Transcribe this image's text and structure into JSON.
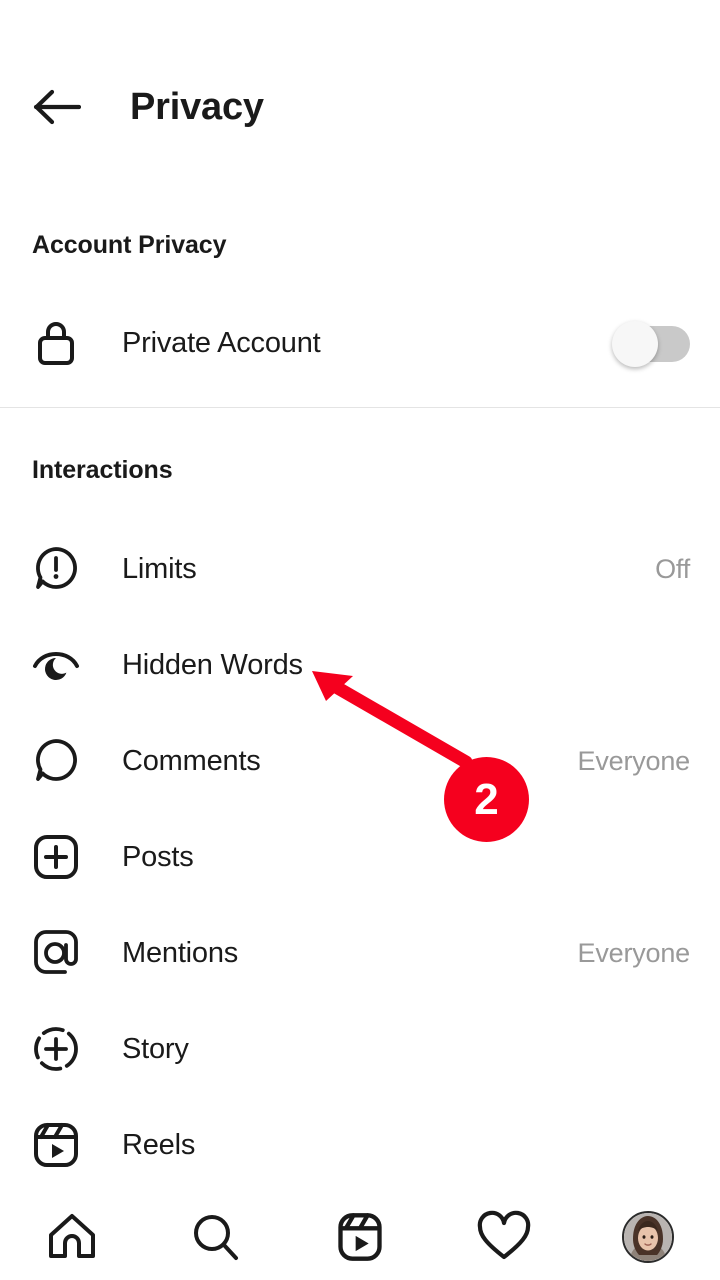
{
  "header": {
    "title": "Privacy",
    "back_icon": "arrow-left-icon"
  },
  "sections": [
    {
      "id": "account-privacy",
      "title": "Account Privacy",
      "rows": [
        {
          "label": "Private Account",
          "icon": "lock-icon",
          "control": "toggle",
          "toggle_on": false
        }
      ]
    },
    {
      "id": "interactions",
      "title": "Interactions",
      "rows": [
        {
          "label": "Limits",
          "icon": "exclamation-bubble-icon",
          "value": "Off"
        },
        {
          "label": "Hidden Words",
          "icon": "eye-hidden-icon",
          "value": ""
        },
        {
          "label": "Comments",
          "icon": "comment-bubble-icon",
          "value": "Everyone"
        },
        {
          "label": "Posts",
          "icon": "plus-square-icon",
          "value": ""
        },
        {
          "label": "Mentions",
          "icon": "at-sign-icon",
          "value": "Everyone"
        },
        {
          "label": "Story",
          "icon": "story-plus-icon",
          "value": ""
        },
        {
          "label": "Reels",
          "icon": "reels-icon",
          "value": ""
        }
      ]
    }
  ],
  "annotation": {
    "badge_number": "2",
    "color": "#F5001E",
    "arrow_icon": "arrow-up-left-icon",
    "points_to": "Hidden Words"
  },
  "bottom_nav": [
    {
      "icon": "home-icon",
      "name": "nav-home"
    },
    {
      "icon": "search-icon",
      "name": "nav-search"
    },
    {
      "icon": "reels-icon",
      "name": "nav-reels"
    },
    {
      "icon": "heart-icon",
      "name": "nav-activity"
    },
    {
      "icon": "avatar-image",
      "name": "nav-profile"
    }
  ],
  "colors": {
    "text_primary": "#1a1a1a",
    "text_secondary": "#999999",
    "divider": "#e4e4e4",
    "toggle_track_off": "#c9c9c9",
    "accent_red": "#F5001E"
  }
}
